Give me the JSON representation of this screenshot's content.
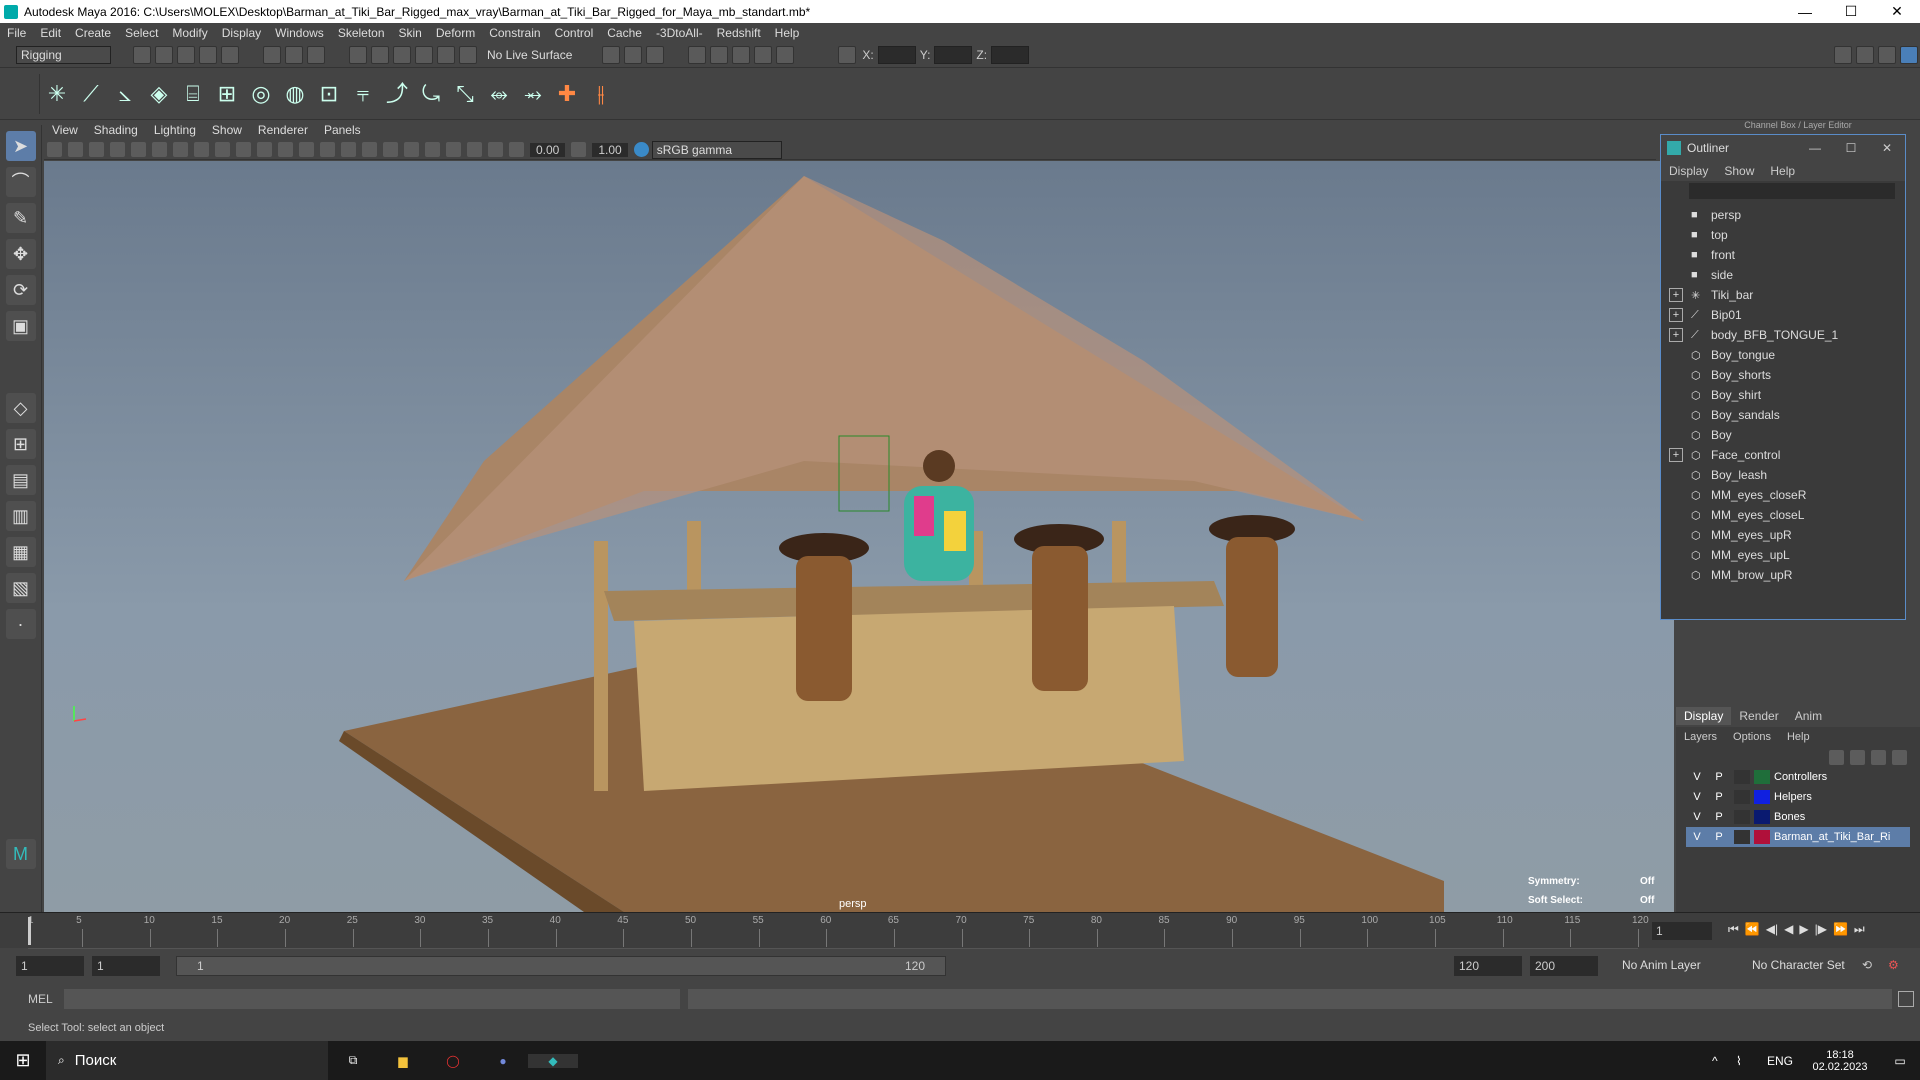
{
  "window": {
    "title": "Autodesk Maya 2016: C:\\Users\\MOLEX\\Desktop\\Barman_at_Tiki_Bar_Rigged_max_vray\\Barman_at_Tiki_Bar_Rigged_for_Maya_mb_standart.mb*",
    "min": "—",
    "max": "☐",
    "close": "✕"
  },
  "menu": [
    "File",
    "Edit",
    "Create",
    "Select",
    "Modify",
    "Display",
    "Windows",
    "Skeleton",
    "Skin",
    "Deform",
    "Constrain",
    "Control",
    "Cache",
    "-3DtoAll-",
    "Redshift",
    "Help"
  ],
  "statusline": {
    "mode": "Rigging",
    "live_surface": "No Live Surface",
    "x_label": "X:",
    "y_label": "Y:",
    "z_label": "Z:"
  },
  "viewport": {
    "menu": [
      "View",
      "Shading",
      "Lighting",
      "Show",
      "Renderer",
      "Panels"
    ],
    "exposure": "0.00",
    "gamma": "1.00",
    "colorspace": "sRGB gamma",
    "camera": "persp",
    "symmetry_label": "Symmetry:",
    "symmetry_value": "Off",
    "softsel_label": "Soft Select:",
    "softsel_value": "Off"
  },
  "outliner": {
    "title": "Outliner",
    "menu": [
      "Display",
      "Show",
      "Help"
    ],
    "items": [
      {
        "label": "persp",
        "icon": "camera-icon",
        "expand": false
      },
      {
        "label": "top",
        "icon": "camera-icon",
        "expand": false
      },
      {
        "label": "front",
        "icon": "camera-icon",
        "expand": false
      },
      {
        "label": "side",
        "icon": "camera-icon",
        "expand": false
      },
      {
        "label": "Tiki_bar",
        "icon": "locator-icon",
        "expand": true
      },
      {
        "label": "Bip01",
        "icon": "joint-icon",
        "expand": true
      },
      {
        "label": "body_BFB_TONGUE_1",
        "icon": "joint-icon",
        "expand": true
      },
      {
        "label": "Boy_tongue",
        "icon": "mesh-icon",
        "expand": false
      },
      {
        "label": "Boy_shorts",
        "icon": "mesh-icon",
        "expand": false
      },
      {
        "label": "Boy_shirt",
        "icon": "mesh-icon",
        "expand": false
      },
      {
        "label": "Boy_sandals",
        "icon": "mesh-icon",
        "expand": false
      },
      {
        "label": "Boy",
        "icon": "mesh-icon",
        "expand": false
      },
      {
        "label": "Face_control",
        "icon": "mesh-icon",
        "expand": true
      },
      {
        "label": "Boy_leash",
        "icon": "mesh-icon",
        "expand": false
      },
      {
        "label": "MM_eyes_closeR",
        "icon": "mesh-icon",
        "expand": false
      },
      {
        "label": "MM_eyes_closeL",
        "icon": "mesh-icon",
        "expand": false
      },
      {
        "label": "MM_eyes_upR",
        "icon": "mesh-icon",
        "expand": false
      },
      {
        "label": "MM_eyes_upL",
        "icon": "mesh-icon",
        "expand": false
      },
      {
        "label": "MM_brow_upR",
        "icon": "mesh-icon",
        "expand": false
      }
    ]
  },
  "channelbox": {
    "header": "Channel Box / Layer Editor",
    "tabs": [
      "Display",
      "Render",
      "Anim"
    ],
    "menu": [
      "Layers",
      "Options",
      "Help"
    ],
    "layers": [
      {
        "v": "V",
        "p": "P",
        "color": "#1f6e3a",
        "name": "Controllers"
      },
      {
        "v": "V",
        "p": "P",
        "color": "#1020e0",
        "name": "Helpers"
      },
      {
        "v": "V",
        "p": "P",
        "color": "#0a1a70",
        "name": "Bones"
      },
      {
        "v": "V",
        "p": "P",
        "color": "#b0103a",
        "name": "Barman_at_Tiki_Bar_Ri"
      }
    ]
  },
  "timeline": {
    "ticks": [
      "5",
      "10",
      "15",
      "20",
      "25",
      "30",
      "35",
      "40",
      "45",
      "50",
      "55",
      "60",
      "65",
      "70",
      "75",
      "80",
      "85",
      "90",
      "95",
      "100",
      "105",
      "110",
      "115",
      "120"
    ],
    "start_tick": "1",
    "current_frame": "1"
  },
  "range": {
    "start": "1",
    "start2": "1",
    "slider_left": "1",
    "slider_right": "120",
    "end": "120",
    "end2": "200",
    "anim_layer": "No Anim Layer",
    "char_set": "No Character Set"
  },
  "cmd": {
    "label": "MEL"
  },
  "help": "Select Tool: select an object",
  "taskbar": {
    "search": "Поиск",
    "lang": "ENG",
    "time": "18:18",
    "date": "02.02.2023"
  }
}
